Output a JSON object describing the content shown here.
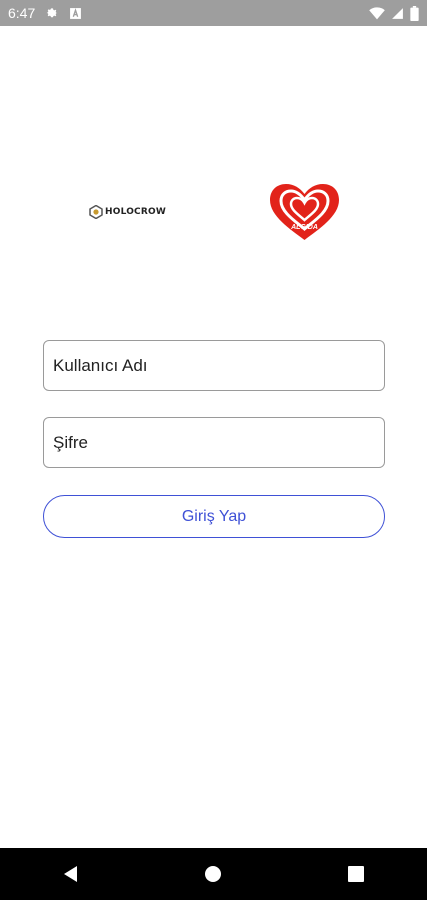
{
  "status_bar": {
    "time": "6:47",
    "icons": [
      "gear-icon",
      "a-box-icon",
      "wifi-icon",
      "signal-icon",
      "battery-icon"
    ]
  },
  "logos": {
    "holocrow": {
      "text": "HOLOCROW"
    },
    "algida": {
      "text": "ALGIDA",
      "color": "#e2231a"
    }
  },
  "login_form": {
    "username_placeholder": "Kullanıcı Adı",
    "password_placeholder": "Şifre",
    "submit_label": "Giriş Yap",
    "accent_color": "#3f51d6"
  },
  "nav_bar": {
    "buttons": [
      "back-icon",
      "home-icon",
      "recents-icon"
    ]
  }
}
